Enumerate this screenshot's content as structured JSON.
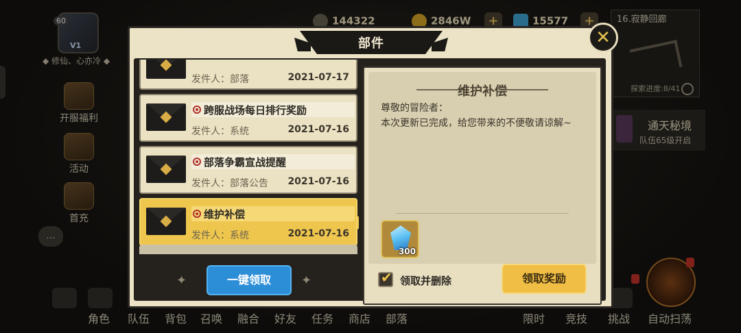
{
  "hud": {
    "level": "60",
    "vip": "V1",
    "player_name": "◆ 修仙、心亦冷 ◆",
    "currency": [
      {
        "name": "power",
        "value": "144322",
        "icon": "sword-icon"
      },
      {
        "name": "gold",
        "value": "2846W",
        "icon": "gold-coin-icon"
      },
      {
        "name": "gems",
        "value": "15577",
        "icon": "gem-icon"
      }
    ],
    "minimap": {
      "title": "16.寂静回廊",
      "progress": "探索进度:8/41"
    },
    "secret_realm": {
      "title": "通天秘境",
      "subtitle": "队伍65级开启"
    },
    "side_menu": [
      {
        "label": "开服福利"
      },
      {
        "label": "活动"
      },
      {
        "label": "首充"
      }
    ],
    "bottom_nav": [
      "角色",
      "队伍",
      "背包",
      "召唤",
      "融合",
      "好友",
      "任务",
      "商店",
      "部落"
    ],
    "bottom_right_nav": [
      "限时",
      "竞技",
      "挑战",
      "自动扫荡"
    ]
  },
  "dialog": {
    "title": "部件",
    "mails": [
      {
        "title": "",
        "sender": "发件人：部落",
        "date": "2021-07-17",
        "selected": false
      },
      {
        "title": "跨服战场每日排行奖励",
        "sender": "发件人：系统",
        "date": "2021-07-16",
        "selected": false
      },
      {
        "title": "部落争霸宣战提醒",
        "sender": "发件人：部落公告",
        "date": "2021-07-16",
        "selected": false
      },
      {
        "title": "维护补偿",
        "sender": "发件人：系统",
        "date": "2021-07-16",
        "selected": true
      }
    ],
    "collect_all_label": "一键领取",
    "detail": {
      "title": "维护补偿",
      "greeting": "尊敬的冒险者：",
      "body": "本次更新已完成，给您带来的不便敬请谅解~",
      "reward": {
        "item": "gem-icon",
        "quantity": "300"
      },
      "checkbox_label": "领取并删除",
      "checkbox_checked": true,
      "claim_label": "领取奖励"
    }
  },
  "colors": {
    "selected_mail": "#efc64d",
    "collect_all_button": "#2d8ed8",
    "claim_button": "#f0be45"
  }
}
